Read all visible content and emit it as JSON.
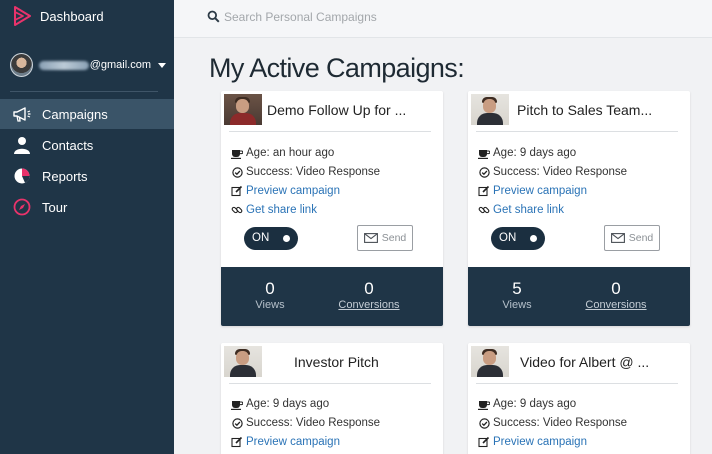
{
  "sidebar": {
    "brand_label": "Dashboard",
    "user_email": "@gmail.com",
    "items": [
      {
        "label": "Campaigns",
        "icon": "megaphone-icon",
        "active": true
      },
      {
        "label": "Contacts",
        "icon": "user-icon"
      },
      {
        "label": "Reports",
        "icon": "pie-chart-icon"
      },
      {
        "label": "Tour",
        "icon": "compass-icon"
      }
    ]
  },
  "search": {
    "placeholder": "Search Personal Campaigns"
  },
  "page_title": "My Active Campaigns:",
  "campaigns": [
    {
      "title": "Demo Follow Up for ...",
      "age": "Age: an hour ago",
      "success": "Success: Video Response",
      "preview": "Preview campaign",
      "share": "Get share link",
      "toggle": "ON",
      "send": "Send",
      "views": "0",
      "views_label": "Views",
      "conversions": "0",
      "conversions_label": "Conversions"
    },
    {
      "title": "Pitch to Sales Team...",
      "age": "Age: 9 days ago",
      "success": "Success: Video Response",
      "preview": "Preview campaign",
      "share": "Get share link",
      "toggle": "ON",
      "send": "Send",
      "views": "5",
      "views_label": "Views",
      "conversions": "0",
      "conversions_label": "Conversions"
    },
    {
      "title": "Investor Pitch",
      "age": "Age: 9 days ago",
      "success": "Success: Video Response",
      "preview": "Preview campaign"
    },
    {
      "title": "Video for Albert @ ...",
      "age": "Age: 9 days ago",
      "success": "Success: Video Response",
      "preview": "Preview campaign"
    }
  ],
  "colors": {
    "sidebar_bg": "#1f3547",
    "sidebar_active": "#3a5468",
    "brand_accent": "#e8336b",
    "link": "#2a73b6",
    "stats_bg": "#1f3547"
  }
}
